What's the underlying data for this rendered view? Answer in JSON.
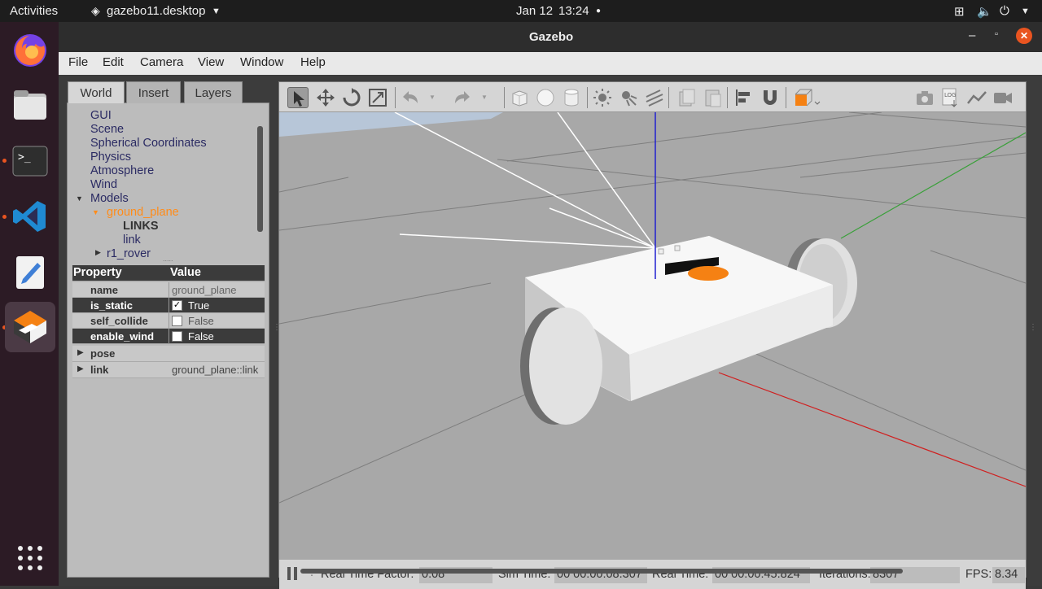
{
  "topbar": {
    "activities": "Activities",
    "app": "gazebo11.desktop",
    "date": "Jan 12",
    "time": "13:24"
  },
  "window": {
    "title": "Gazebo"
  },
  "menu": [
    "File",
    "Edit",
    "Camera",
    "View",
    "Window",
    "Help"
  ],
  "tabs": [
    "World",
    "Insert",
    "Layers"
  ],
  "tree": {
    "items": [
      "GUI",
      "Scene",
      "Spherical Coordinates",
      "Physics",
      "Atmosphere",
      "Wind"
    ],
    "models": "Models",
    "ground_plane": "ground_plane",
    "links": "LINKS",
    "link": "link",
    "rover": "r1_rover",
    "handle": "....."
  },
  "props": {
    "hdr_property": "Property",
    "hdr_value": "Value",
    "rows": [
      {
        "name": "name",
        "value": "ground_plane"
      },
      {
        "name": "is_static",
        "value": "True"
      },
      {
        "name": "self_collide",
        "value": "False"
      },
      {
        "name": "enable_wind",
        "value": "False"
      }
    ],
    "pose": "pose",
    "link_name": "link",
    "link_value": "ground_plane::link"
  },
  "toolbar_icons": [
    "select-arrow-icon",
    "move-icon",
    "rotate-icon",
    "scale-icon",
    "undo-icon",
    "undo-dropdown-icon",
    "redo-icon",
    "redo-dropdown-icon",
    "box-icon",
    "sphere-icon",
    "cylinder-icon",
    "pointlight-icon",
    "spotlight-icon",
    "directionallight-icon",
    "copy-icon",
    "paste-icon",
    "align-icon",
    "magnet-icon",
    "view-angle-icon",
    "screenshot-icon",
    "log-icon",
    "plot-icon",
    "video-icon"
  ],
  "status": {
    "rtf_label": "Real Time Factor:",
    "rtf": "0.08",
    "sim_label": "Sim Time:",
    "sim": "00 00:00:08.307",
    "real_label": "Real Time:",
    "real": "00 00:00:45.824",
    "iter_label": "Iterations:",
    "iter": "8307",
    "fps_label": "FPS:",
    "fps": "8.34",
    "step": "."
  },
  "colors": {
    "accent": "#e95420",
    "selected": "#ff8c1a"
  }
}
